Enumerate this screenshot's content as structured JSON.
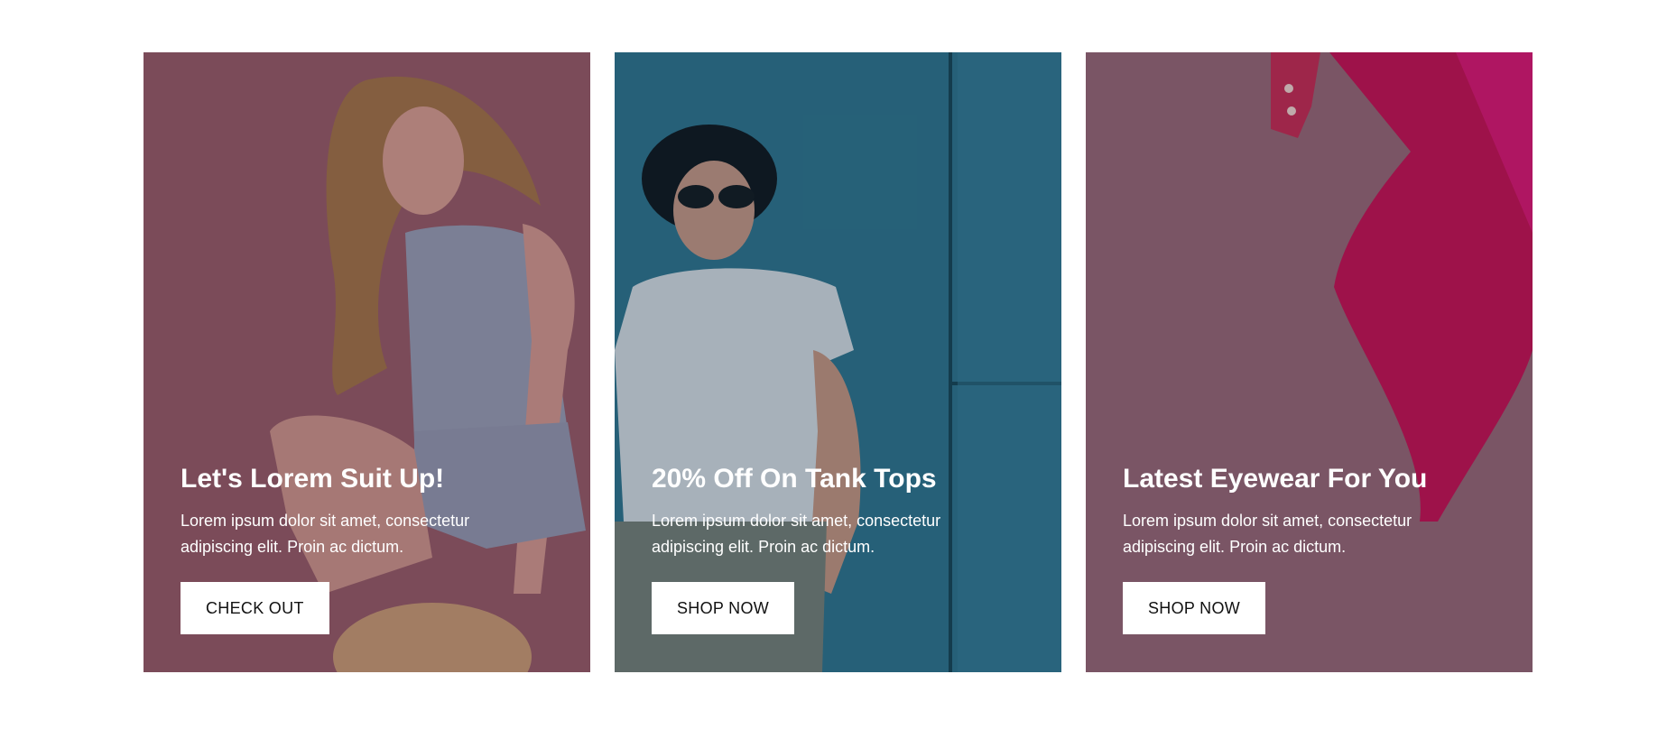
{
  "cards": [
    {
      "title": "Let's Lorem Suit Up!",
      "text": "Lorem ipsum dolor sit amet, consectetur adipiscing elit. Proin ac dictum.",
      "button": "CHECK OUT",
      "bg_color": "#8a5d69",
      "image": "woman-in-denim-photo"
    },
    {
      "title": "20% Off On Tank Tops",
      "text": "Lorem ipsum dolor sit amet, consectetur adipiscing elit. Proin ac dictum.",
      "button": "SHOP NOW",
      "bg_color": "#2f6b82",
      "image": "man-in-hat-photo"
    },
    {
      "title": "Latest Eyewear For You",
      "text": "Lorem ipsum dolor sit amet, consectetur adipiscing elit. Proin ac dictum.",
      "button": "SHOP NOW",
      "bg_color": "#7d5f6c",
      "image": "pink-heel-shoe-photo"
    }
  ]
}
